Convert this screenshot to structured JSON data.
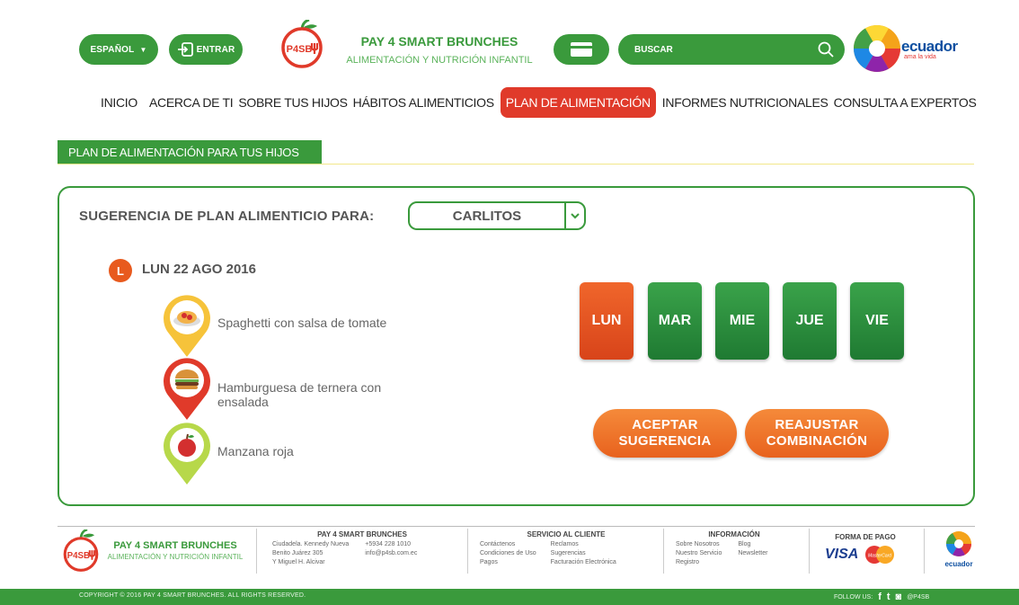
{
  "header": {
    "language_label": "ESPAÑOL",
    "login_label": "ENTRAR",
    "logo_text": "P4SB",
    "brand_title": "PAY 4 SMART BRUNCHES",
    "brand_subtitle": "ALIMENTACIÓN Y NUTRICIÓN INFANTIL",
    "search_placeholder": "BUSCAR",
    "partner_logo_word": "ecuador",
    "partner_logo_tagline": "ama la vida"
  },
  "nav": {
    "items": [
      {
        "label": "INICIO",
        "active": false
      },
      {
        "label": "ACERCA DE TI",
        "active": false
      },
      {
        "label": "SOBRE TUS HIJOS",
        "active": false
      },
      {
        "label": "HÁBITOS ALIMENTICIOS",
        "active": false
      },
      {
        "label": "PLAN DE ALIMENTACIÓN",
        "active": true
      },
      {
        "label": "INFORMES NUTRICIONALES",
        "active": false
      },
      {
        "label": "CONSULTA A EXPERTOS",
        "active": false
      }
    ]
  },
  "section": {
    "title": "PLAN DE ALIMENTACIÓN PARA TUS HIJOS"
  },
  "plan": {
    "label": "SUGERENCIA DE PLAN ALIMENTICIO PARA:",
    "selected_child": "CARLITOS",
    "day_badge": "L",
    "date": "LUN 22 AGO 2016",
    "meals": [
      {
        "name": "Spaghetti con salsa de tomate",
        "pin_color": "#f6c33a",
        "icon": "spaghetti-icon"
      },
      {
        "name": "Hamburguesa de ternera con ensalada",
        "pin_color": "#e03a2a",
        "icon": "burger-icon"
      },
      {
        "name": "Manzana roja",
        "pin_color": "#b7d84a",
        "icon": "apple-icon"
      }
    ],
    "days": [
      "LUN",
      "MAR",
      "MIE",
      "JUE",
      "VIE"
    ],
    "active_day": "LUN",
    "accept_label": "ACEPTAR SUGERENCIA",
    "readjust_label": "REAJUSTAR COMBINACIÓN"
  },
  "footer": {
    "brand_title": "PAY 4 SMART BRUNCHES",
    "brand_subtitle": "ALIMENTACIÓN Y NUTRICIÓN INFANTIL",
    "contact_title": "PAY 4 SMART BRUNCHES",
    "address_lines": [
      "Ciudadela. Kennedy Nueva",
      "Benito Juárez 305",
      "Y Miguel H. Alcivar"
    ],
    "phone": "+5934 228 1010",
    "email": "info@p4sb.com.ec",
    "service_title": "SERVICIO AL CLIENTE",
    "service_col1": [
      "Contáctenos",
      "Condiciones de Uso",
      "Pagos"
    ],
    "service_col2": [
      "Reclamos",
      "Sugerencias",
      "Facturación Electrónica"
    ],
    "info_title": "INFORMACIÓN",
    "info_col1": [
      "Sobre Nosotros",
      "Nuestro Servicio",
      "Registro"
    ],
    "info_col2": [
      "Blog",
      "Newsletter"
    ],
    "payment_title": "FORMA DE PAGO",
    "payment_visa": "VISA",
    "payment_mc": "MasterCard",
    "partner_word": "ecuador",
    "copyright": "COPYRIGHT © 2016 PAY 4 SMART BRUNCHES. ALL RIGHTS RESERVED.",
    "follow_label": "FOLLOW US:",
    "handle": "@P4SB"
  },
  "colors": {
    "primary_green": "#3a9a3c",
    "active_red": "#e03a2a",
    "orange": "#f0662b"
  }
}
